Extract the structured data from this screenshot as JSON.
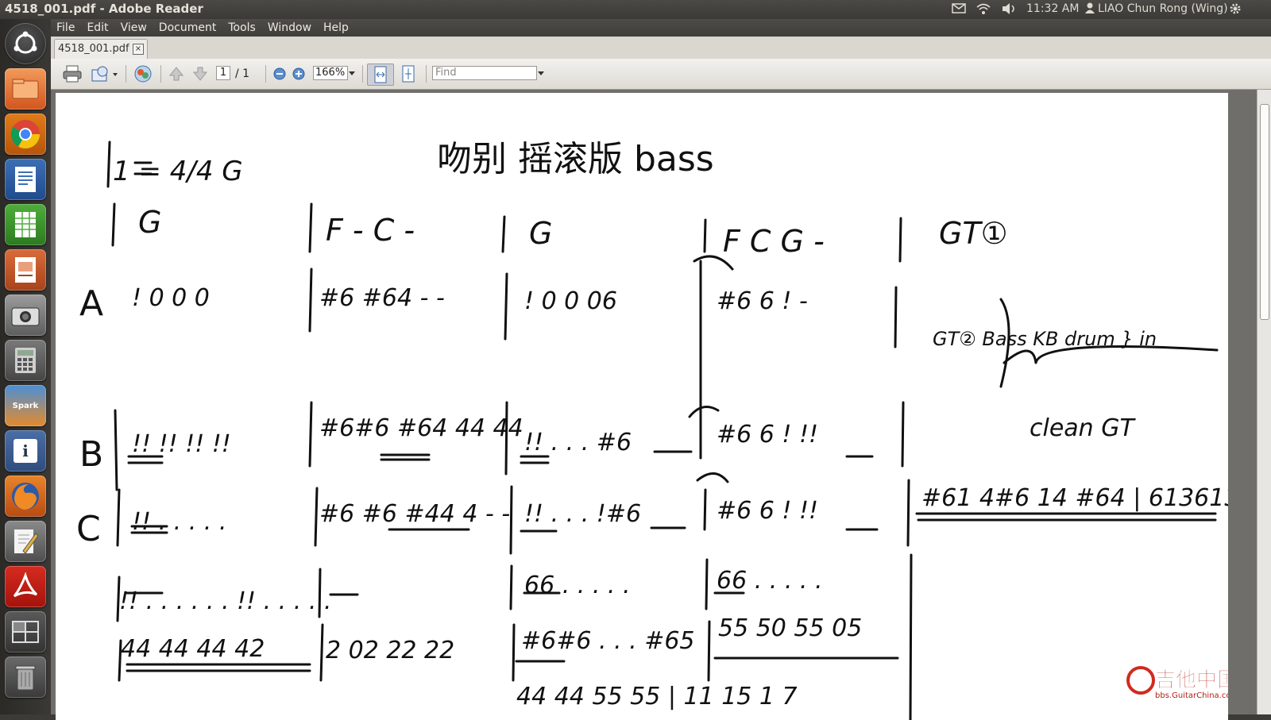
{
  "window": {
    "title": "4518_001.pdf - Adobe Reader"
  },
  "panel": {
    "time": "11:32 AM",
    "user": "LIAO Chun Rong (Wing)"
  },
  "menu": {
    "file": "File",
    "edit": "Edit",
    "view": "View",
    "document": "Document",
    "tools": "Tools",
    "window": "Window",
    "help": "Help"
  },
  "tab": {
    "label": "4518_001.pdf"
  },
  "toolbar": {
    "page_current": "1",
    "page_total": "/ 1",
    "zoom": "166%",
    "find_placeholder": "Find"
  },
  "launcher": {
    "spark_label": "Spark",
    "info_label": "i"
  },
  "score": {
    "key": "1 = 4/4 G",
    "title": "吻别 摇滚版 bass",
    "chords": [
      "G",
      "F - C -",
      "G",
      "F C G -"
    ],
    "gt1": "GT①",
    "intro_label": "GT② Bass KB drum } in",
    "sections": [
      "A",
      "B",
      "C"
    ],
    "clean": "clean GT",
    "watermark": "吉他中国",
    "watermark_url": "bbs.GuitarChina.com"
  }
}
